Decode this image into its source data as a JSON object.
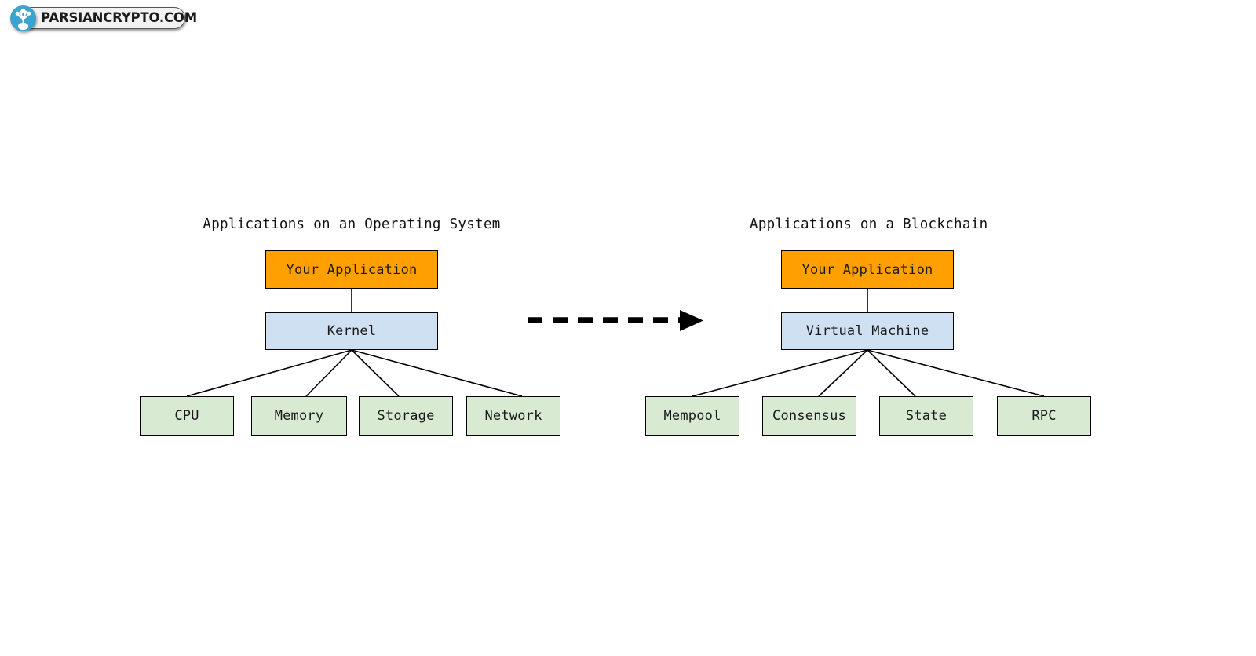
{
  "watermark": {
    "text": "PARSIANCRYPTO.COM",
    "logo_icon": "parsian-crypto-plant-logo-icon",
    "brand_color": "#3ba3cd"
  },
  "diagram": {
    "type": "comparison-tree-diagram",
    "colors": {
      "application": "#ffa000",
      "layer": "#cfe0f2",
      "resource": "#d9ead3",
      "stroke": "#000000",
      "background": "#ffffff"
    },
    "transition_arrow": {
      "icon": "dashed-right-arrow-icon",
      "style": "dashed",
      "direction": "right"
    },
    "left": {
      "title": "Applications on an Operating System",
      "application": "Your Application",
      "layer": "Kernel",
      "resources": [
        "CPU",
        "Memory",
        "Storage",
        "Network"
      ]
    },
    "right": {
      "title": "Applications on a Blockchain",
      "application": "Your Application",
      "layer": "Virtual Machine",
      "resources": [
        "Mempool",
        "Consensus",
        "State",
        "RPC"
      ]
    }
  }
}
